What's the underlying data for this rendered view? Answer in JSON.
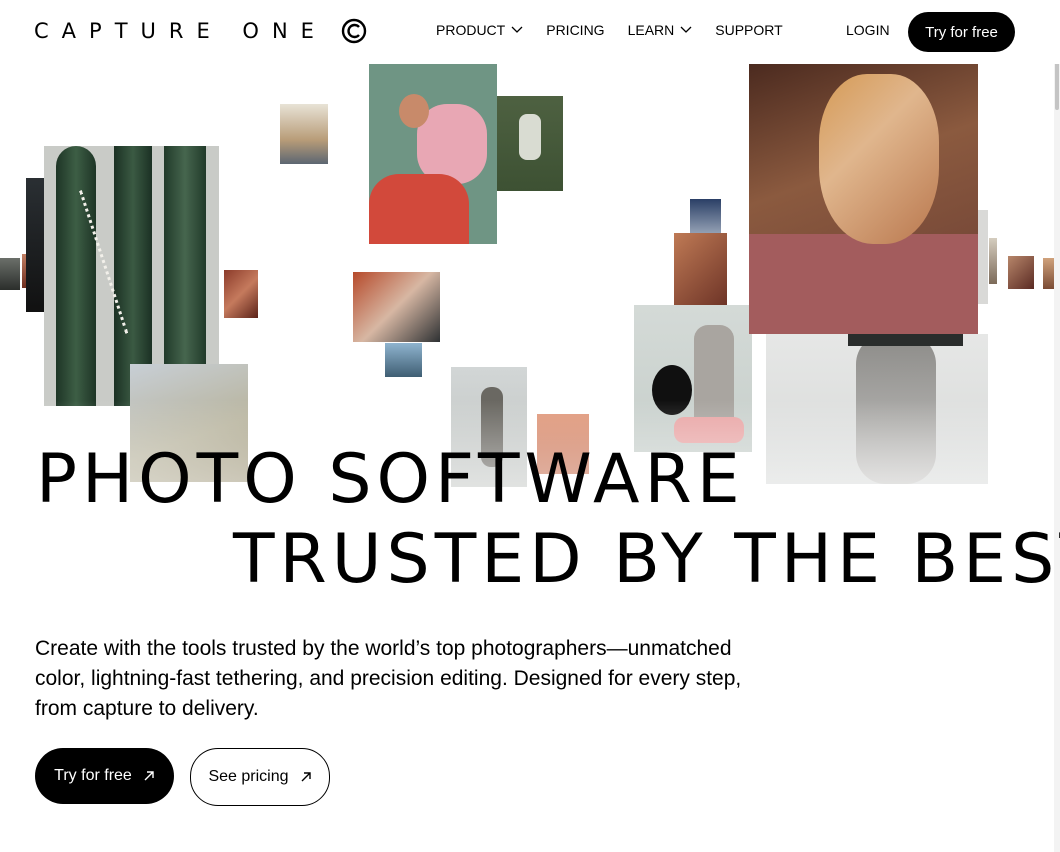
{
  "header": {
    "logo_text": "CAPTURE ONE",
    "nav": [
      {
        "label": "PRODUCT",
        "has_dropdown": true
      },
      {
        "label": "PRICING",
        "has_dropdown": false
      },
      {
        "label": "LEARN",
        "has_dropdown": true
      },
      {
        "label": "SUPPORT",
        "has_dropdown": false
      }
    ],
    "login_label": "LOGIN",
    "try_label": "Try for free"
  },
  "hero": {
    "headline_line1": "PHOTO SOFTWARE",
    "headline_line2": "TRUSTED BY THE BEST",
    "description": "Create with the tools trusted by the world’s top photographers—unmatched color, lightning-fast tethering, and precision editing. Designed for every step, from capture to delivery.",
    "primary_cta": "Try for free",
    "secondary_cta": "See pricing"
  },
  "colors": {
    "text": "#000000",
    "background": "#ffffff",
    "button_primary_bg": "#000000",
    "button_primary_text": "#ffffff"
  },
  "icons": {
    "logo_mark": "capture-one-c-logo",
    "dropdown": "chevron-down-icon",
    "cta_arrow": "arrow-up-right-icon"
  }
}
